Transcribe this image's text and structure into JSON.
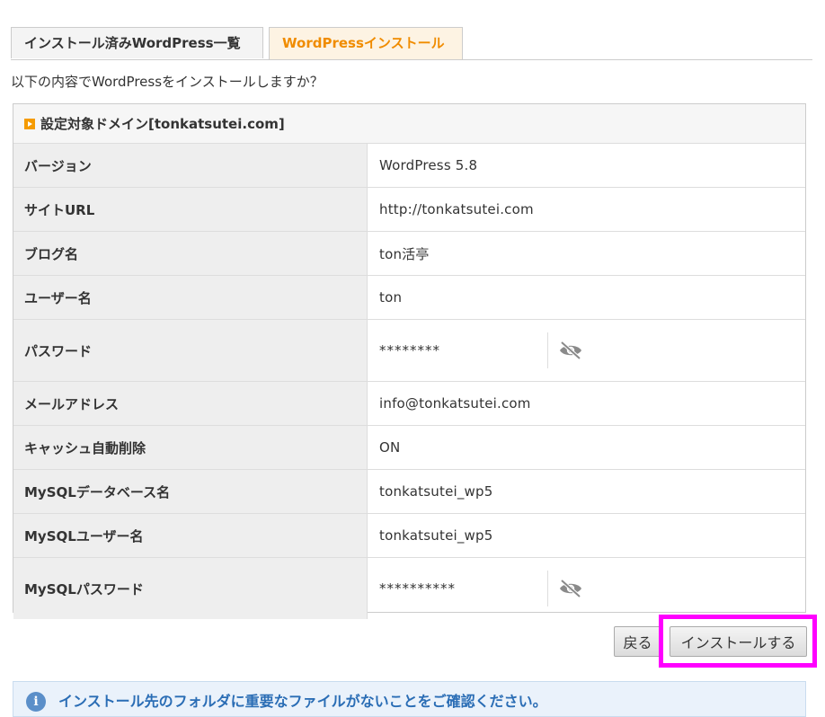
{
  "tabs": [
    {
      "label": "インストール済みWordPress一覧",
      "active": false
    },
    {
      "label": "WordPressインストール",
      "active": true
    }
  ],
  "intro": "以下の内容でWordPressをインストールしますか？",
  "panel": {
    "title": "設定対象ドメイン[tonkatsutei.com]",
    "rows": [
      {
        "label": "バージョン",
        "value": "WordPress 5.8"
      },
      {
        "label": "サイトURL",
        "value": "http://tonkatsutei.com"
      },
      {
        "label": "ブログ名",
        "value": "ton活亭"
      },
      {
        "label": "ユーザー名",
        "value": "ton"
      },
      {
        "label": "パスワード",
        "value": "********"
      },
      {
        "label": "メールアドレス",
        "value": "info@tonkatsutei.com"
      },
      {
        "label": "キャッシュ自動削除",
        "value": "ON"
      },
      {
        "label": "MySQLデータベース名",
        "value": "tonkatsutei_wp5"
      },
      {
        "label": "MySQLユーザー名",
        "value": "tonkatsutei_wp5"
      },
      {
        "label": "MySQLパスワード",
        "value": "**********"
      }
    ]
  },
  "buttons": {
    "back": "戻る",
    "install": "インストールする"
  },
  "note": "インストール先のフォルダに重要なファイルがないことをご確認ください。",
  "colors": {
    "accent": "#f08c00",
    "highlight": "#ff00ff",
    "info": "#2a6db5"
  },
  "icons": {
    "password_toggle": "eye-slash-icon",
    "note": "info-icon",
    "title_marker": "play-square-icon"
  }
}
